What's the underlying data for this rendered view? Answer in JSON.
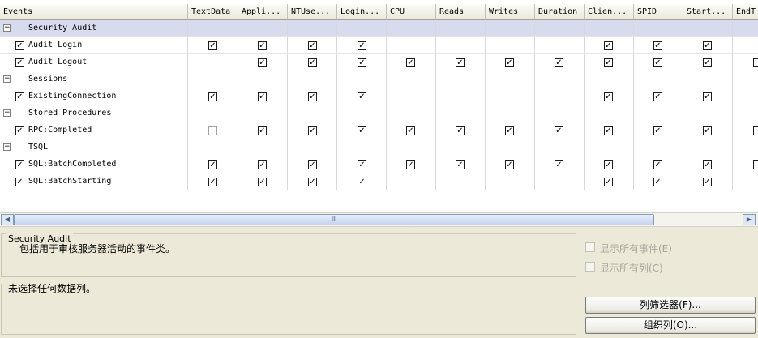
{
  "columns": [
    "Events",
    "TextData",
    "Appli...",
    "NTUse...",
    "Login...",
    "CPU",
    "Reads",
    "Writes",
    "Duration",
    "Clien...",
    "SPID",
    "Start...",
    "EndT"
  ],
  "rows": [
    {
      "type": "group",
      "label": "Security Audit",
      "collapse": "−",
      "selected": true
    },
    {
      "type": "event",
      "label": "Audit Login",
      "checked": true,
      "cells": [
        "on",
        "on",
        "on",
        "on",
        "",
        "",
        "",
        "",
        "on",
        "on",
        "on",
        ""
      ]
    },
    {
      "type": "event",
      "label": "Audit Logout",
      "checked": true,
      "cells": [
        "",
        "on",
        "on",
        "on",
        "on",
        "on",
        "on",
        "on",
        "on",
        "on",
        "on",
        "edge"
      ]
    },
    {
      "type": "group",
      "label": "Sessions",
      "collapse": "−",
      "selected": false
    },
    {
      "type": "event",
      "label": "ExistingConnection",
      "checked": true,
      "cells": [
        "on",
        "on",
        "on",
        "on",
        "",
        "",
        "",
        "",
        "on",
        "on",
        "on",
        ""
      ]
    },
    {
      "type": "group",
      "label": "Stored Procedures",
      "collapse": "−",
      "selected": false
    },
    {
      "type": "event",
      "label": "RPC:Completed",
      "checked": true,
      "cells": [
        "off",
        "on",
        "on",
        "on",
        "on",
        "on",
        "on",
        "on",
        "on",
        "on",
        "on",
        "edge"
      ]
    },
    {
      "type": "group",
      "label": "TSQL",
      "collapse": "−",
      "selected": false
    },
    {
      "type": "event",
      "label": "SQL:BatchCompleted",
      "checked": true,
      "cells": [
        "on",
        "on",
        "on",
        "on",
        "on",
        "on",
        "on",
        "on",
        "on",
        "on",
        "on",
        "edge"
      ]
    },
    {
      "type": "event",
      "label": "SQL:BatchStarting",
      "checked": true,
      "cells": [
        "on",
        "on",
        "on",
        "on",
        "",
        "",
        "",
        "",
        "on",
        "on",
        "on",
        ""
      ]
    }
  ],
  "scrollbar": {
    "left_arrow": "◀",
    "right_arrow": "▶",
    "thumb_grip": "III"
  },
  "event_desc": {
    "title": "Security Audit",
    "text": "包括用于审核服务器活动的事件类。"
  },
  "column_desc": {
    "text": "未选择任何数据列。"
  },
  "options": {
    "show_all_events": "显示所有事件(E)",
    "show_all_columns": "显示所有列(C)"
  },
  "buttons": {
    "column_filters": "列筛选器(F)...",
    "organize_columns": "组织列(O)..."
  },
  "glyphs": {
    "check": "✓"
  }
}
